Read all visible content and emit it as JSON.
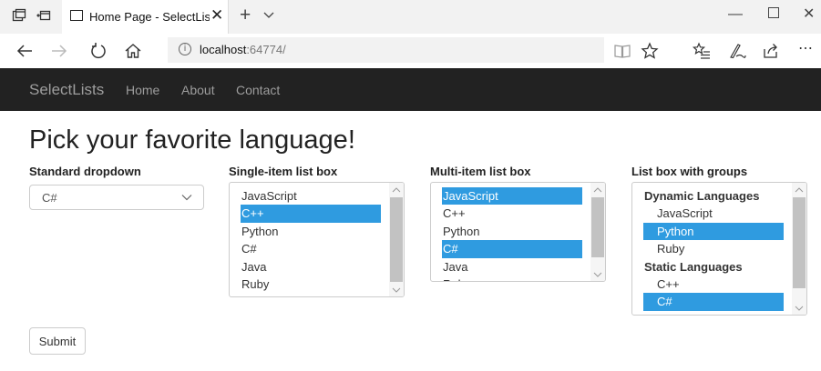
{
  "browser": {
    "tab_title": "Home Page - SelectLists",
    "address_host": "localhost",
    "address_port": ":64774/"
  },
  "site": {
    "brand": "SelectLists",
    "nav": [
      "Home",
      "About",
      "Contact"
    ]
  },
  "page": {
    "heading": "Pick your favorite language!",
    "submit_label": "Submit"
  },
  "standard_dropdown": {
    "label": "Standard dropdown",
    "selected": "C#"
  },
  "single_list": {
    "label": "Single-item list box",
    "options": [
      "JavaScript",
      "C++",
      "Python",
      "C#",
      "Java",
      "Ruby"
    ],
    "selected": [
      "C++"
    ]
  },
  "multi_list": {
    "label": "Multi-item list box",
    "options": [
      "JavaScript",
      "C++",
      "Python",
      "C#",
      "Java",
      "Ruby"
    ],
    "selected": [
      "JavaScript",
      "C#"
    ]
  },
  "grouped_list": {
    "label": "List box with groups",
    "groups": [
      {
        "name": "Dynamic Languages",
        "options": [
          "JavaScript",
          "Python",
          "Ruby"
        ]
      },
      {
        "name": "Static Languages",
        "options": [
          "C++",
          "C#"
        ]
      }
    ],
    "selected": [
      "Python",
      "C#"
    ]
  },
  "colors": {
    "navbar_bg": "#222222",
    "selection": "#2f9be0"
  }
}
